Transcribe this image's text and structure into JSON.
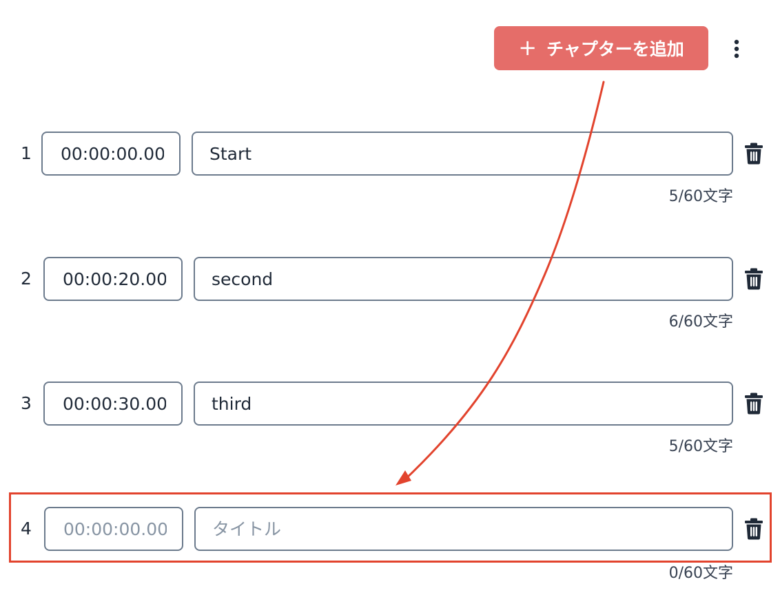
{
  "toolbar": {
    "add_chapter_label": "チャプターを追加",
    "add_icon": "plus-icon",
    "menu_icon": "more-vertical-icon",
    "accent_color": "#e56d69"
  },
  "chapters": [
    {
      "index": "1",
      "time": "00:00:00.000",
      "title": "Start",
      "counter": "5/60文字"
    },
    {
      "index": "2",
      "time": "00:00:20.000",
      "title": "second",
      "counter": "6/60文字"
    },
    {
      "index": "3",
      "time": "00:00:30.000",
      "title": "third",
      "counter": "5/60文字"
    },
    {
      "index": "4",
      "time": "",
      "time_placeholder": "00:00:00.000",
      "title": "",
      "title_placeholder": "タイトル",
      "counter": "0/60文字"
    }
  ],
  "row_icon": "trash-icon",
  "annotation": {
    "color": "#e2432d",
    "marks": [
      "arrow",
      "highlight-box"
    ]
  }
}
